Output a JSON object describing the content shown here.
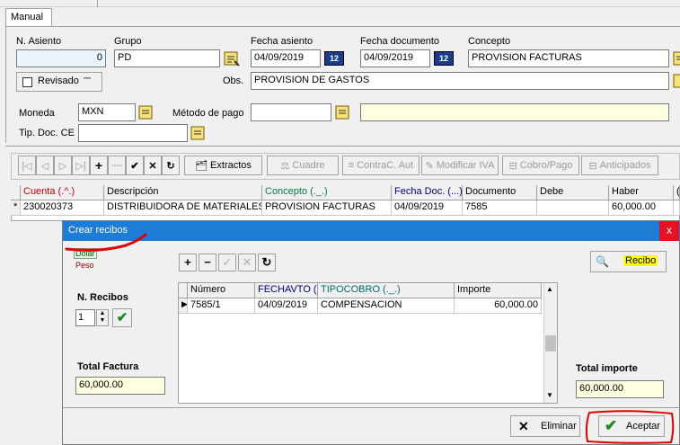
{
  "tab": {
    "label": "Manual"
  },
  "form": {
    "n_asiento_label": "N. Asiento",
    "n_asiento_value": "0",
    "grupo_label": "Grupo",
    "grupo_value": "PD",
    "fecha_asiento_label": "Fecha asiento",
    "fecha_asiento_value": "04/09/2019",
    "fecha_documento_label": "Fecha documento",
    "fecha_documento_value": "04/09/2019",
    "concepto_label": "Concepto",
    "concepto_value": "PROVISION FACTURAS",
    "revisado_label": "Revisado",
    "obs_label": "Obs.",
    "obs_value": "PROVISION DE GASTOS",
    "moneda_label": "Moneda",
    "moneda_value": "MXN",
    "metodo_pago_label": "Método de pago",
    "metodo_pago_value": "",
    "tip_doc_label": "Tip. Doc. CE",
    "tip_doc_value": "",
    "cal_label": "12"
  },
  "toolbar": {
    "extractos": "Extractos",
    "cuadre": "Cuadre",
    "contrac": "ContraC. Aut",
    "modificar_iva": "Modificar IVA",
    "cobro_pago": "Cobro/Pago",
    "anticipados": "Anticipados"
  },
  "grid": {
    "headers": [
      "Cuenta (.^.)",
      "Descripción",
      "Concepto (._.)",
      "Fecha Doc. (...)",
      "Documento",
      "Debe",
      "Haber",
      "("
    ],
    "row": {
      "marker": "*",
      "cuenta": "230020373",
      "descripcion": "DISTRIBUIDORA DE MATERIALES",
      "concepto": "PROVISION FACTURAS",
      "fecha": "04/09/2019",
      "documento": "7585",
      "debe": "",
      "haber": "60,000.00"
    }
  },
  "dialog": {
    "title": "Crear recibos",
    "close": "x",
    "currency_dolar": "Dolar",
    "currency_peso": "Peso",
    "n_recibos_label": "N. Recibos",
    "n_recibos_value": "1",
    "total_factura_label": "Total Factura",
    "total_factura_value": "60,000.00",
    "total_importe_label": "Total importe",
    "total_importe_value": "60,000.00",
    "recibo_button": "Recibo",
    "eliminar_button": "Eliminar",
    "aceptar_button": "Aceptar",
    "grid_headers": [
      "Número",
      "FECHAVTO (.",
      "TIPOCOBRO (._.)",
      "Importe"
    ],
    "grid_row": {
      "numero": "7585/1",
      "fecha": "04/09/2019",
      "tipo": "COMPENSACION",
      "importe": "60,000.00"
    }
  },
  "colors": {
    "annotation_red": "#e00000",
    "dialog_title": "#1c7cd6",
    "accent_yellow": "#ffffe1"
  }
}
